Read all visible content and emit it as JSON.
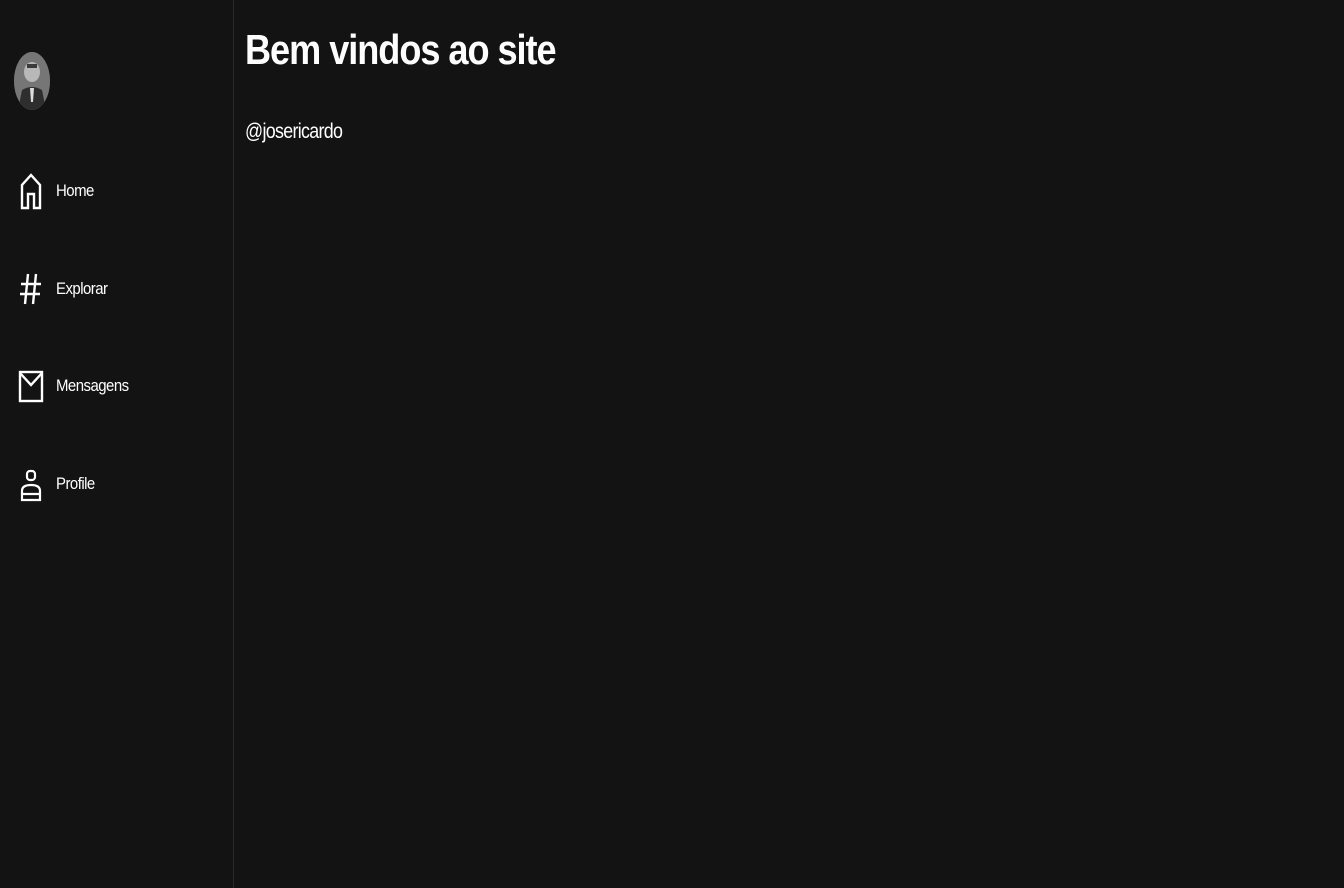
{
  "sidebar": {
    "nav": [
      {
        "label": "Home",
        "icon": "home-icon"
      },
      {
        "label": "Explorar",
        "icon": "hashtag-icon"
      },
      {
        "label": "Mensagens",
        "icon": "mail-icon"
      },
      {
        "label": "Profile",
        "icon": "user-icon"
      }
    ]
  },
  "main": {
    "title": "Bem vindos ao site",
    "username": "@josericardo"
  },
  "colors": {
    "background": "#131313",
    "text": "#ffffff",
    "divider": "#2a2a2a"
  }
}
